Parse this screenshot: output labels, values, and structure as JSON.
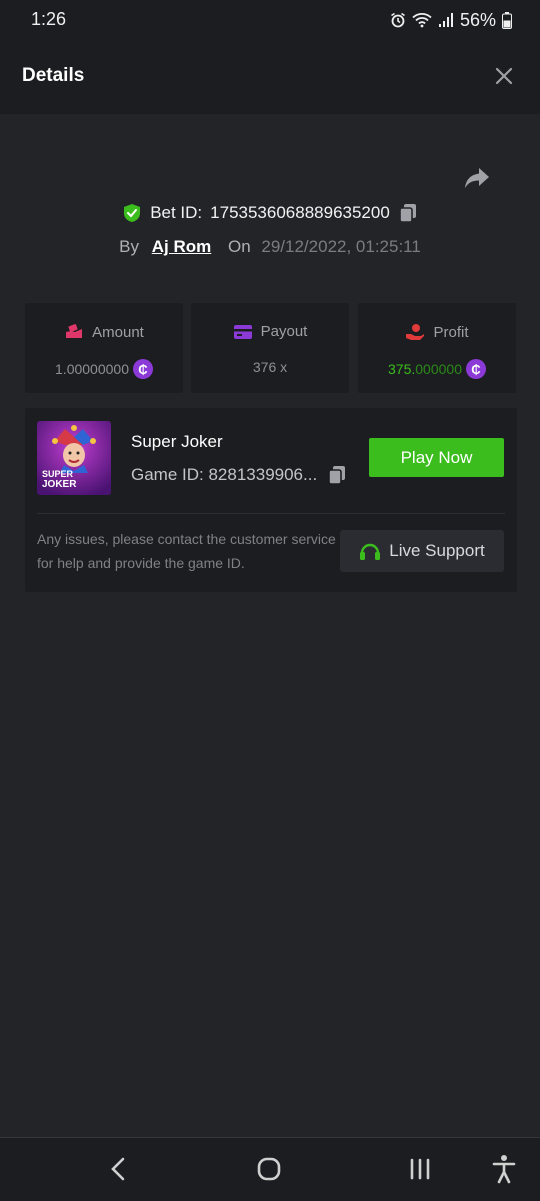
{
  "status_bar": {
    "time": "1:26",
    "battery": "56%",
    "icons": [
      "alarm-icon",
      "wifi-icon",
      "signal-icon",
      "battery-icon"
    ]
  },
  "header": {
    "title": "Details",
    "close_icon": "close-icon"
  },
  "bet": {
    "id_label": "Bet ID:",
    "id_value": "1753536068889635200",
    "by_label": "By",
    "user": "Aj Rom",
    "on_label": "On",
    "datetime": "29/12/2022, 01:25:11"
  },
  "stats": {
    "amount": {
      "label": "Amount",
      "value": "1.00000000",
      "icon": "amount-icon"
    },
    "payout": {
      "label": "Payout",
      "value": "376 x",
      "icon": "payout-card-icon"
    },
    "profit": {
      "label": "Profit",
      "value_bright": "375.",
      "value_dim": "000000",
      "icon": "profit-hand-icon"
    }
  },
  "game": {
    "thumb_text_line1": "SUPER",
    "thumb_text_line2": "JOKER",
    "name": "Super Joker",
    "id_text": "Game ID: 8281339906...",
    "play_label": "Play Now",
    "issue_text": "Any issues, please contact the customer service for help and provide the game ID.",
    "support_label": "Live Support"
  },
  "colors": {
    "background": "#232428",
    "panel": "#1c1d20",
    "accent_green": "#3bbd1d",
    "coin_purple": "#8b3ad8",
    "amount_icon": "#e0376a",
    "payout_icon": "#8b3ad8",
    "profit_icon": "#e03a3a",
    "shield": "#3bbd1d"
  }
}
